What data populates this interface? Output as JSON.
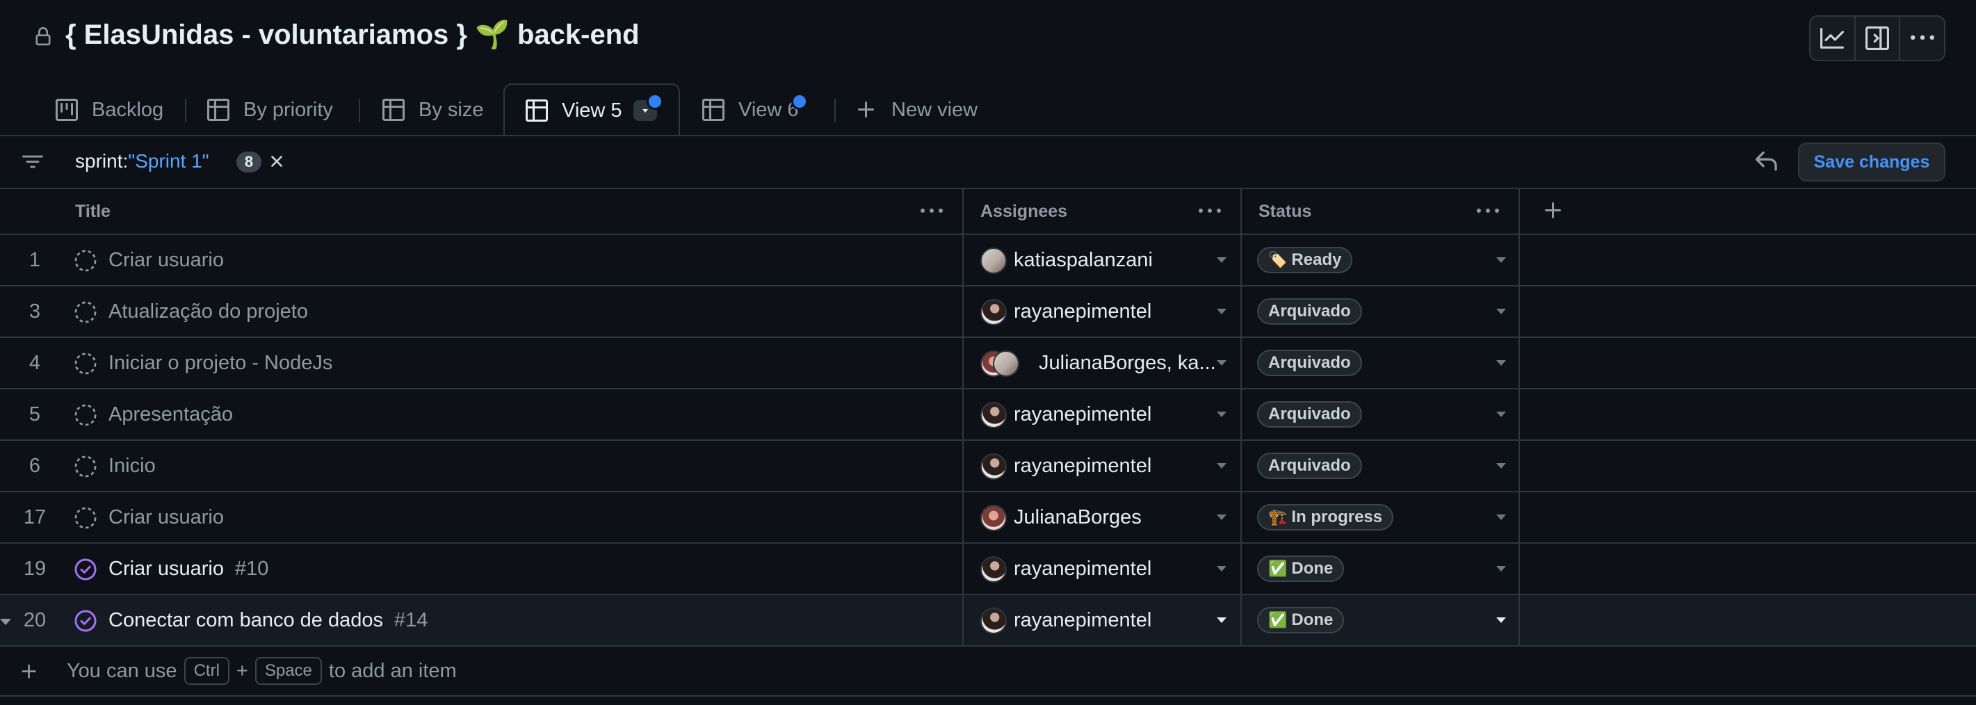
{
  "header": {
    "title": "{ ElasUnidas - voluntariamos } 🌱 back-end",
    "buttons": [
      "insights-icon",
      "side-panel-icon",
      "more-options-icon"
    ]
  },
  "tabs": [
    {
      "label": "Backlog",
      "icon": "board-icon"
    },
    {
      "label": "By priority",
      "icon": "table-icon"
    },
    {
      "label": "By size",
      "icon": "table-icon"
    },
    {
      "label": "View 5",
      "icon": "table-icon",
      "active": true,
      "unsaved": true
    },
    {
      "label": "View 6",
      "icon": "table-icon",
      "unsaved": true
    },
    {
      "label": "New view",
      "icon": "plus-icon"
    }
  ],
  "filter": {
    "key": "sprint:",
    "value": "\"Sprint 1\"",
    "count": "8"
  },
  "actions": {
    "save_label": "Save changes"
  },
  "columns": {
    "title": "Title",
    "assignees": "Assignees",
    "status": "Status"
  },
  "rows": [
    {
      "num": "1",
      "type": "draft",
      "title": "Criar usuario",
      "issue": "",
      "assignee": "katiaspalanzani",
      "status": "Ready",
      "status_emoji": "🏷️"
    },
    {
      "num": "3",
      "type": "draft",
      "title": "Atualização do projeto",
      "issue": "",
      "assignee": "rayanepimentel",
      "status": "Arquivado",
      "status_emoji": ""
    },
    {
      "num": "4",
      "type": "draft",
      "title": "Iniciar o projeto - NodeJs",
      "issue": "",
      "assignee": "JulianaBorges, ka...",
      "status": "Arquivado",
      "status_emoji": ""
    },
    {
      "num": "5",
      "type": "draft",
      "title": "Apresentação",
      "issue": "",
      "assignee": "rayanepimentel",
      "status": "Arquivado",
      "status_emoji": ""
    },
    {
      "num": "6",
      "type": "draft",
      "title": "Inicio",
      "issue": "",
      "assignee": "rayanepimentel",
      "status": "Arquivado",
      "status_emoji": ""
    },
    {
      "num": "17",
      "type": "draft",
      "title": "Criar usuario",
      "issue": "",
      "assignee": "JulianaBorges",
      "status": "In progress",
      "status_emoji": "🏗️"
    },
    {
      "num": "19",
      "type": "issue",
      "title": "Criar usuario",
      "issue": "#10",
      "assignee": "rayanepimentel",
      "status": "Done",
      "status_emoji": "✅"
    },
    {
      "num": "20",
      "type": "issue",
      "title": "Conectar com banco de dados",
      "issue": "#14",
      "assignee": "rayanepimentel",
      "status": "Done",
      "status_emoji": "✅"
    }
  ],
  "footer": {
    "prefix": "You can use",
    "key1": "Ctrl",
    "plus": "+",
    "key2": "Space",
    "suffix": "to add an item"
  },
  "colors": {
    "background": "#0d1117",
    "border": "#30363d",
    "accent": "#2f81f7",
    "link": "#58a6ff",
    "done": "#a371f7"
  }
}
